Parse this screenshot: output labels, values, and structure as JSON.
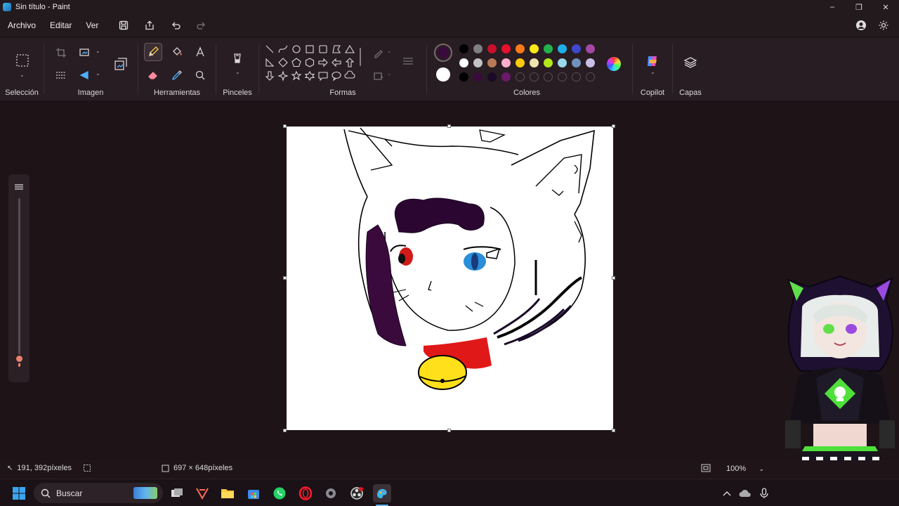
{
  "window": {
    "title": "Sin título - Paint",
    "minimize_glyph": "–",
    "maximize_glyph": "❐",
    "close_glyph": "✕"
  },
  "menu": {
    "items": [
      "Archivo",
      "Editar",
      "Ver"
    ],
    "quick_actions": [
      "save-icon",
      "share-icon",
      "undo-icon",
      "redo-icon"
    ],
    "right_icons": [
      "account-icon",
      "settings-icon"
    ]
  },
  "ribbon": {
    "groups": {
      "seleccion": "Selección",
      "imagen": "Imagen",
      "herramientas": "Herramientas",
      "pinceles": "Pinceles",
      "formas": "Formas",
      "colores": "Colores",
      "copilot": "Copilot",
      "capas": "Capas"
    },
    "active_tool": "pencil-icon",
    "colors": {
      "primary": "#3b0a3d",
      "secondary": "#ffffff",
      "row1": [
        "#000000",
        "#7f7f7f",
        "#c8102e",
        "#e8112d",
        "#ff7a1a",
        "#ffe81a",
        "#22b14c",
        "#1eaee8",
        "#3f48cc",
        "#a349a4"
      ],
      "row2": [
        "#ffffff",
        "#c3c3c3",
        "#b97a57",
        "#ffaec9",
        "#ffc90e",
        "#efe4b0",
        "#b5e61d",
        "#99d9ea",
        "#7092be",
        "#c8bfe7"
      ],
      "row3": [
        "#000000",
        "#3b0a3d",
        "#1a0a28",
        "#6a1a6a",
        "",
        "",
        "",
        "",
        "",
        ""
      ]
    }
  },
  "status": {
    "cursor_position": "191, 392píxeles",
    "canvas_size": "697 × 648píxeles",
    "zoom": "100%"
  },
  "zoom_slider_level": 0.05,
  "taskbar": {
    "search_label": "Buscar",
    "apps": [
      "start-icon",
      "search-icon",
      "widgets-icon",
      "task-view-icon",
      "vivaldi-icon",
      "file-explorer-icon",
      "store-icon",
      "whatsapp-icon",
      "opera-icon",
      "settings-icon",
      "obs-icon",
      "paint-icon"
    ]
  }
}
